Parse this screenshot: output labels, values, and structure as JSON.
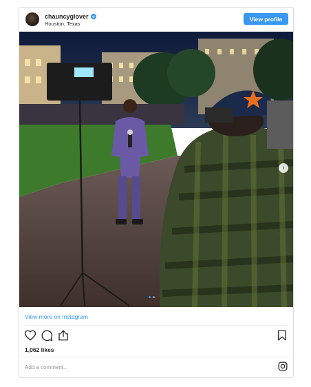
{
  "post": {
    "username": "chauncyglover",
    "location": "Houston, Texas",
    "view_profile_label": "View profile",
    "verified": true,
    "photo_subject": "Reporter in purple suit on location at night with camera operator",
    "view_more_label": "View more on Instagram",
    "likes": "1,062 likes",
    "comment_placeholder": "Add a comment...",
    "carousel_count": 2,
    "carousel_active": 1
  },
  "colors": {
    "accent": "#3897f0",
    "text": "#262626",
    "border": "#dbdbdb",
    "muted": "#8e8e8e"
  },
  "icons": [
    "verified-badge-icon",
    "heart-icon",
    "comment-icon",
    "share-icon",
    "bookmark-icon",
    "instagram-icon",
    "chevron-right-icon"
  ]
}
